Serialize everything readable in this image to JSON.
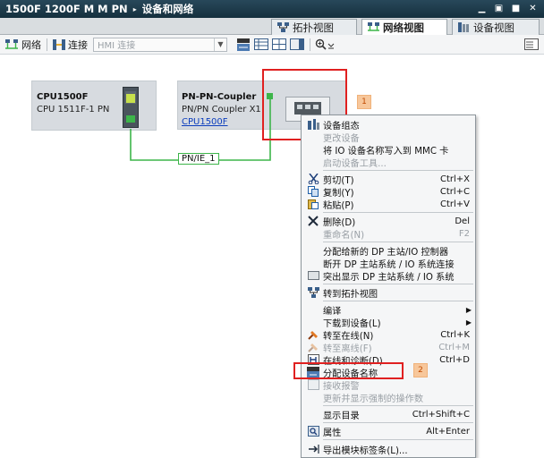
{
  "titlebar": {
    "project": "1500F 1200F M M PN",
    "separator": "▸",
    "section": "设备和网络",
    "controls": [
      "▁",
      "▣",
      "■",
      "✕"
    ]
  },
  "view_tabs": [
    {
      "label": "拓扑视图"
    },
    {
      "label": "网络视图"
    },
    {
      "label": "设备视图"
    }
  ],
  "toolbar": {
    "network_label": "网络",
    "connections_label": "连接",
    "connection_type": "HMI 连接"
  },
  "devices": {
    "cpu": {
      "title": "CPU1500F",
      "subtitle": "CPU 1511F-1 PN"
    },
    "coupler": {
      "title": "PN-PN-Coupler",
      "subtitle": "PN/PN Coupler X1",
      "link": "CPU1500F"
    },
    "network": {
      "label": "PN/IE_1"
    }
  },
  "callouts": {
    "first": "1",
    "second": "2"
  },
  "context_menu": {
    "items": [
      {
        "label": "设备组态",
        "shortcut": "",
        "icon": "device-config-icon",
        "enabled": true
      },
      {
        "label": "更改设备",
        "shortcut": "",
        "icon": "",
        "enabled": false
      },
      {
        "label": "将 IO 设备名称写入到 MMC 卡",
        "shortcut": "",
        "icon": "",
        "enabled": true
      },
      {
        "label": "启动设备工具...",
        "shortcut": "",
        "icon": "",
        "enabled": false
      },
      {
        "label": "剪切(T)",
        "shortcut": "Ctrl+X",
        "icon": "scissors-icon",
        "enabled": true
      },
      {
        "label": "复制(Y)",
        "shortcut": "Ctrl+C",
        "icon": "copy-icon",
        "enabled": true
      },
      {
        "label": "粘贴(P)",
        "shortcut": "Ctrl+V",
        "icon": "paste-icon",
        "enabled": true
      },
      {
        "label": "删除(D)",
        "shortcut": "Del",
        "icon": "delete-icon",
        "enabled": true
      },
      {
        "label": "重命名(N)",
        "shortcut": "F2",
        "icon": "",
        "enabled": false
      },
      {
        "label": "分配给新的 DP 主站/IO 控制器",
        "shortcut": "",
        "icon": "",
        "enabled": true
      },
      {
        "label": "断开 DP 主站系统 / IO 系统连接",
        "shortcut": "",
        "icon": "",
        "enabled": true
      },
      {
        "label": "突出显示 DP 主站系统 / IO 系统",
        "shortcut": "",
        "icon": "highlight-icon",
        "enabled": true
      },
      {
        "label": "转到拓扑视图",
        "shortcut": "",
        "icon": "topology-icon",
        "enabled": true
      },
      {
        "label": "编译",
        "shortcut": "",
        "icon": "",
        "enabled": true
      },
      {
        "label": "下载到设备(L)",
        "shortcut": "",
        "icon": "",
        "enabled": true
      },
      {
        "label": "转至在线(N)",
        "shortcut": "Ctrl+K",
        "icon": "go-online-icon",
        "enabled": true
      },
      {
        "label": "转至离线(F)",
        "shortcut": "Ctrl+M",
        "icon": "go-offline-icon",
        "enabled": false
      },
      {
        "label": "在线和诊断(D)",
        "shortcut": "Ctrl+D",
        "icon": "diagnostics-icon",
        "enabled": true
      },
      {
        "label": "分配设备名称",
        "shortcut": "",
        "icon": "assign-name-icon",
        "enabled": true
      },
      {
        "label": "接收报警",
        "shortcut": "",
        "icon": "receive-alarm-icon",
        "enabled": false
      },
      {
        "label": "更新并显示强制的操作数",
        "shortcut": "",
        "icon": "",
        "enabled": false
      },
      {
        "label": "显示目录",
        "shortcut": "Ctrl+Shift+C",
        "icon": "",
        "enabled": true
      },
      {
        "label": "属性",
        "shortcut": "Alt+Enter",
        "icon": "properties-icon",
        "enabled": true
      },
      {
        "label": "导出模块标签条(L)...",
        "shortcut": "",
        "icon": "export-icon",
        "enabled": true
      }
    ]
  },
  "colors": {
    "accent_red": "#e02020",
    "network_green": "#3db54a",
    "device_fill": "#d7dbe0"
  }
}
